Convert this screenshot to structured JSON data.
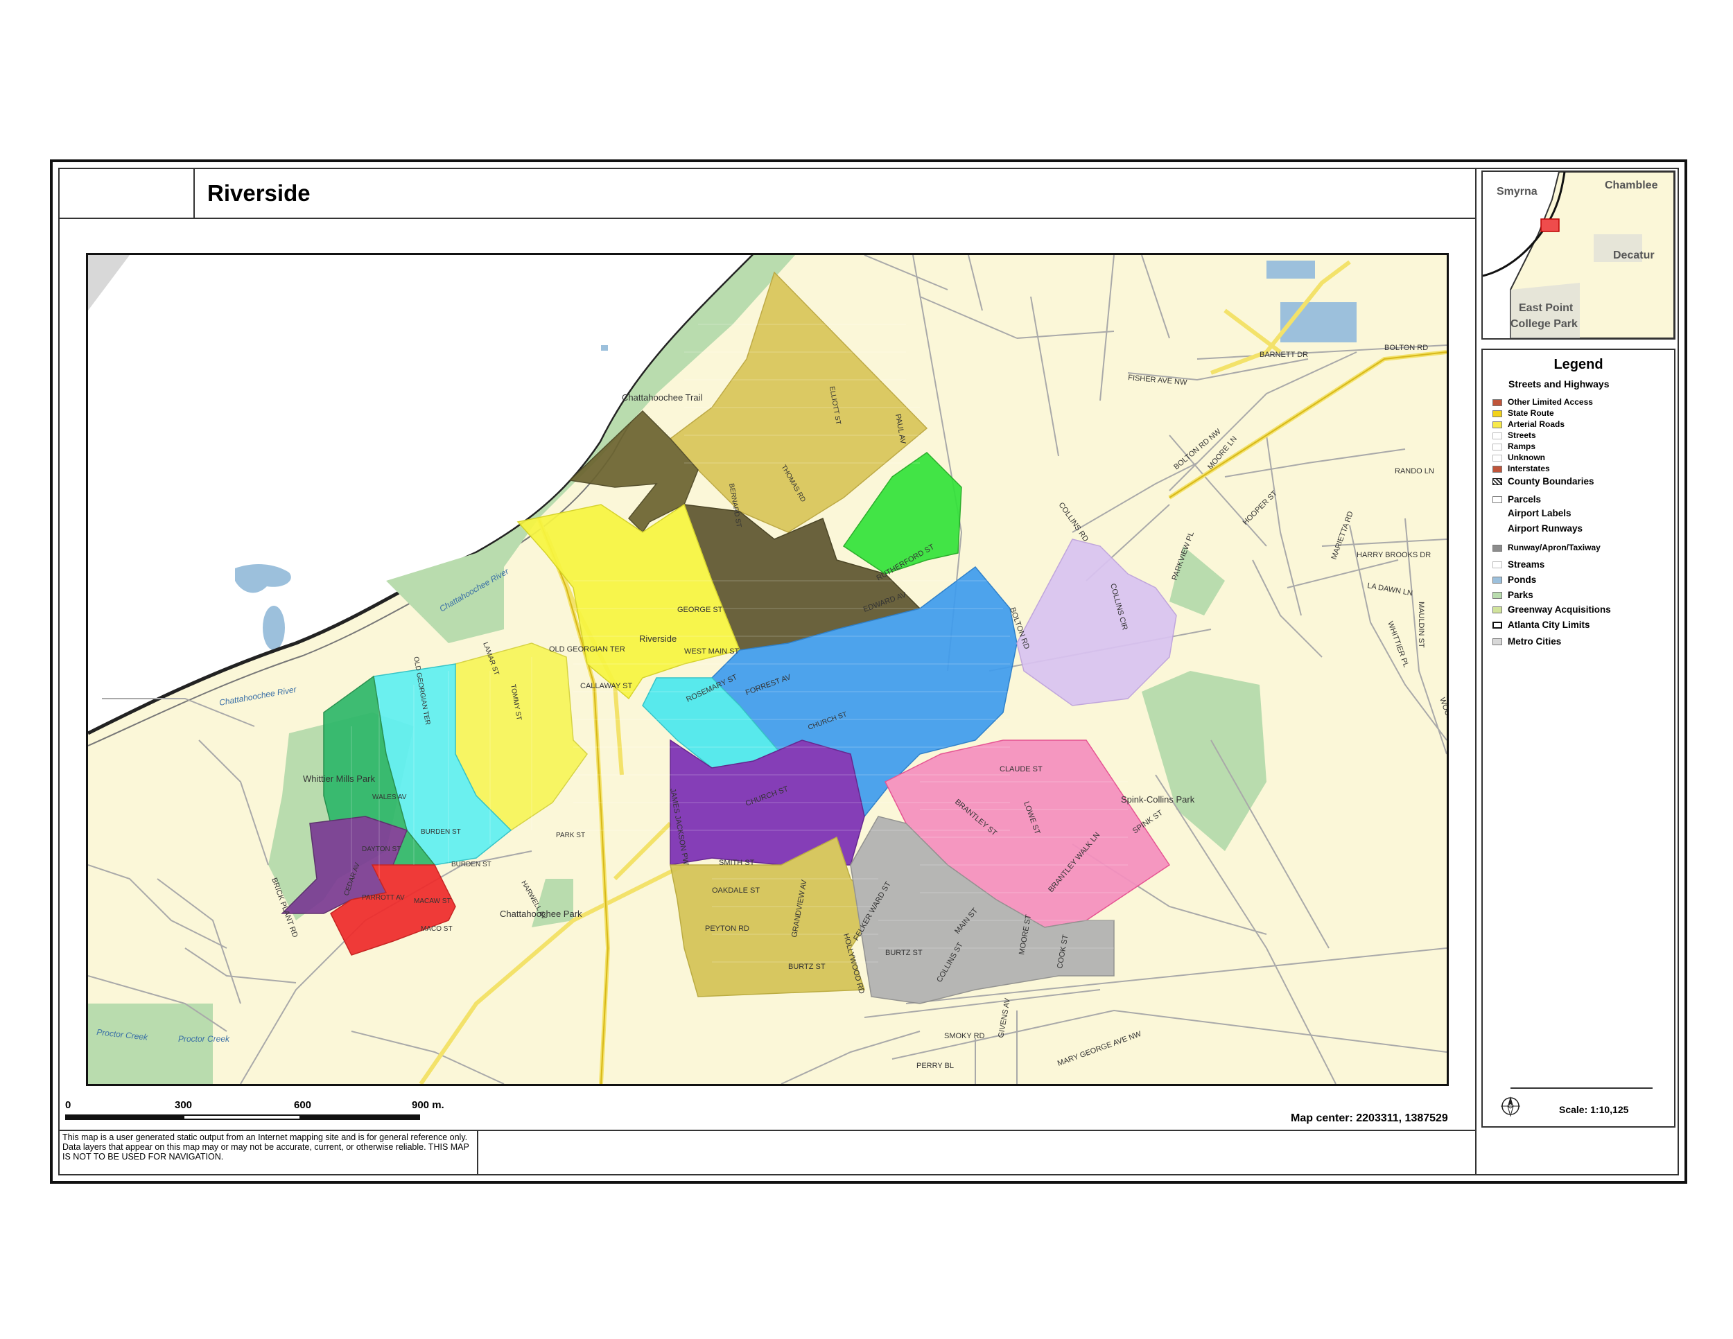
{
  "title": "Riverside",
  "inset": {
    "cities": [
      "Smyrna",
      "Chamblee",
      "Decatur",
      "East Point",
      "College Park"
    ]
  },
  "legend": {
    "title": "Legend",
    "subtitle": "Streets and Highways",
    "street_items": [
      "Other Limited Access",
      "State Route",
      "Arterial Roads",
      "Streets",
      "Ramps",
      "Unknown",
      "Interstates"
    ],
    "layer_items": [
      "County Boundaries",
      "Parcels",
      "Airport Labels",
      "Airport Runways",
      "Runway/Apron/Taxiway",
      "Streams",
      "Ponds",
      "Parks",
      "Greenway Acquisitions",
      "Atlanta City Limits",
      "Metro Cities"
    ],
    "colors": {
      "ponds": "#9cc0dc",
      "parks": "#b9dcae",
      "greenway": "#d1e39c",
      "metro": "#d8d8d8",
      "runway": "#8c8c8c",
      "interstate": "#c0553a",
      "state_route": "#f2d21a",
      "arterial": "#f7e94b"
    },
    "scale": "Scale: 1:10,125"
  },
  "scalebar": {
    "labels": [
      "0",
      "300",
      "600",
      "900 m."
    ]
  },
  "map_center": "Map center: 2203311, 1387529",
  "disclaimer": "This map is a user generated static output from an Internet mapping site and is for general reference only.  Data layers that appear on this map may or may not be accurate, current, or otherwise reliable.  THIS MAP IS NOT TO BE USED FOR NAVIGATION.",
  "map": {
    "parks": [
      "Chattahoochee Trail",
      "Whittier Mills Park",
      "Chattahoochee Park",
      "Spink-Collins Park"
    ],
    "place": "Riverside",
    "waterways": [
      "Chattahoochee River",
      "Chattahoochee River",
      "Proctor Creek",
      "Proctor Creek"
    ],
    "streets": [
      "OLD GEORGIAN TER",
      "JAMES JACKSON PW",
      "BRICK PLANT RD",
      "HOLLYWOOD RD",
      "PERRY BL",
      "SMOKY RD",
      "GIVENS AV",
      "MARY GEORGE AVE NW",
      "SPINK ST",
      "COLLINS RD",
      "BOLTON RD NW",
      "BARNETT DR",
      "BOLTON RD",
      "FISHER AVE NW",
      "MOORE LN",
      "HOOPER ST",
      "RANDO LN",
      "HARRY BROOKS DR",
      "MARIETTA RD",
      "WHITTIER PL",
      "MAULDIN ST",
      "WOOD TL",
      "LA DAWN LN",
      "PARKVIEW PL",
      "PAUL AV",
      "RUTHERFORD ST",
      "EDWARD AV",
      "GEORGE ST",
      "WEST MAIN ST",
      "ROSEMARY ST",
      "FORREST AV",
      "CALLAWAY ST",
      "CHURCH ST",
      "SMITH ST",
      "OAKDALE ST",
      "PEYTON RD",
      "GRANDVIEW AV",
      "BURTZ ST",
      "BURTZ ST",
      "FELKER WARD ST",
      "COLLINS ST",
      "MAIN ST",
      "MOORE ST",
      "COOK ST",
      "BRANTLEY ST",
      "BRANTLEY WALK LN",
      "CLAUDE ST",
      "LOWE ST",
      "BOLTON RD",
      "COLLINS CIR",
      "WALES AV",
      "DAYTON ST",
      "BURDEN ST",
      "BURDEN ST",
      "MACAW ST",
      "MACO ST",
      "PARROTT AV",
      "CEDAR AV",
      "HARWELL AV",
      "TOMMY ST",
      "ELLIOTT ST",
      "THOMAS RD",
      "BERNARD ST",
      "LAMAR ST",
      "OLD GEORGIAN TER",
      "CHURCH ST",
      "PARK ST"
    ]
  }
}
